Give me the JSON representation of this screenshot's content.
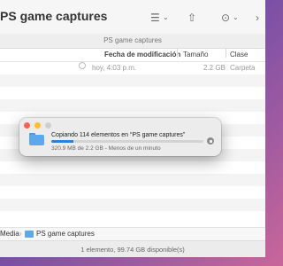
{
  "window": {
    "title": "PS game captures",
    "path_title": "PS game captures"
  },
  "toolbar": {
    "view_icon": "list-icon",
    "share_icon": "share-icon",
    "more_icon": "ellipsis-icon",
    "search_icon": "search-icon"
  },
  "columns": {
    "date": "Fecha de modificación",
    "size": "Tamaño",
    "kind": "Clase"
  },
  "rows": [
    {
      "date": "hoy, 4:03 p.m.",
      "size": "2.2 GB",
      "kind": "Carpeta"
    }
  ],
  "copy_dialog": {
    "title": "Copiando 114 elementos en “PS game captures”",
    "detail": "320.9 MB de 2.2 GB - Menos de un minuto",
    "progress_fraction": 0.145
  },
  "pathbar": {
    "parent": "Media",
    "separator": "›",
    "current": "PS game captures"
  },
  "status": {
    "text": "1 elemento, 99.74 GB disponible(s)"
  },
  "colors": {
    "accent": "#2f7fe0",
    "folder": "#5ba8ec"
  }
}
